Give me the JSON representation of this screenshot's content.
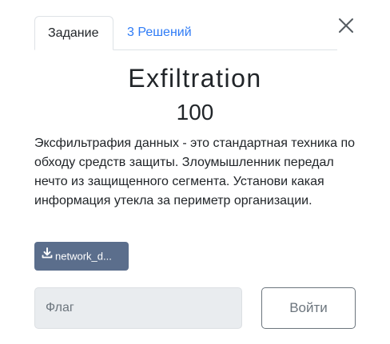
{
  "dialog": {
    "close_icon": "close-icon"
  },
  "tabs": [
    {
      "label": "Задание",
      "active": true
    },
    {
      "label": "3 Решений",
      "active": false
    }
  ],
  "challenge": {
    "name": "Exfiltration",
    "points": "100",
    "description": "Эксфильтрафия данных - это стандартная техника по обходу средств защиты. Злоумышленник передал нечто из защищенного сегмента. Установи какая информация утекла за периметр организации."
  },
  "file": {
    "icon": "download-icon",
    "label": "network_d..."
  },
  "submission": {
    "placeholder": "Флаг",
    "value": "",
    "button_label": "Войти"
  },
  "colors": {
    "tab_link": "#2f7cf6",
    "file_button": "#5b6e8c",
    "input_bg": "#e9ecef",
    "submit_border": "#6c757d"
  }
}
